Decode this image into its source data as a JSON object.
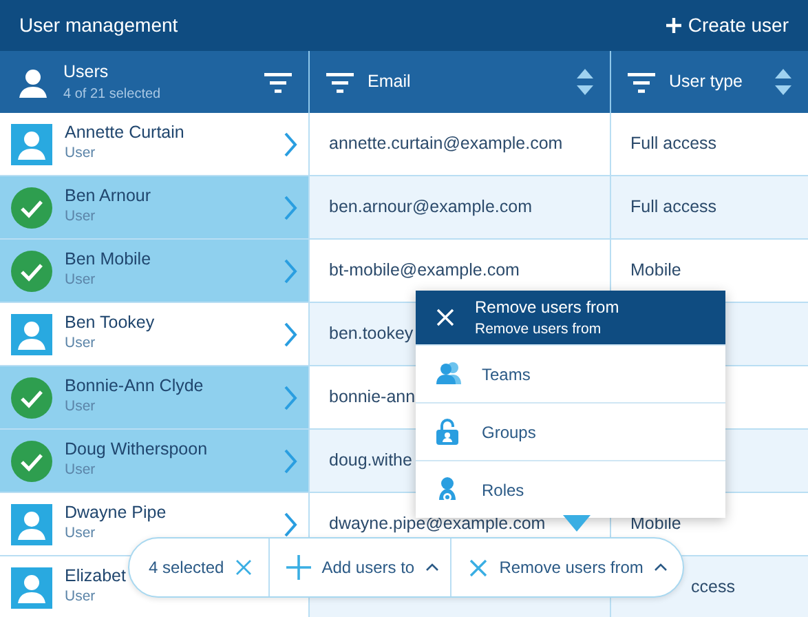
{
  "header": {
    "title": "User management",
    "create_label": "Create user"
  },
  "columns": [
    {
      "kind": "users",
      "label": "Users",
      "subtitle": "4 of 21 selected"
    },
    {
      "kind": "email",
      "label": "Email"
    },
    {
      "kind": "type",
      "label": "User type"
    }
  ],
  "rows": [
    {
      "name": "Annette Curtain",
      "role": "User",
      "selected": false,
      "email": "annette.curtain@example.com",
      "user_type": "Full access"
    },
    {
      "name": "Ben Arnour",
      "role": "User",
      "selected": true,
      "email": "ben.arnour@example.com",
      "user_type": "Full access"
    },
    {
      "name": "Ben Mobile",
      "role": "User",
      "selected": true,
      "email": "bt-mobile@example.com",
      "user_type": "Mobile"
    },
    {
      "name": "Ben Tookey",
      "role": "User",
      "selected": false,
      "email": "ben.tookey"
    },
    {
      "name": "Bonnie-Ann Clyde",
      "role": "User",
      "selected": true,
      "email": "bonnie-ann"
    },
    {
      "name": "Doug Witherspoon",
      "role": "User",
      "selected": true,
      "email": "doug.withe"
    },
    {
      "name": "Dwayne Pipe",
      "role": "User",
      "selected": false,
      "email": "dwayne.pipe@example.com",
      "user_type": "Mobile"
    },
    {
      "name": "Elizabet",
      "role": "User",
      "selected": false,
      "user_type": "ccess"
    }
  ],
  "popup": {
    "title": "Remove users from",
    "subtitle": "Remove users from",
    "items": [
      {
        "label": "Teams",
        "kind": "teams"
      },
      {
        "label": "Groups",
        "kind": "groups"
      },
      {
        "label": "Roles",
        "kind": "roles"
      }
    ]
  },
  "action_bar": {
    "count_label": "4 selected",
    "add_label": "Add users to",
    "remove_label": "Remove users from"
  }
}
